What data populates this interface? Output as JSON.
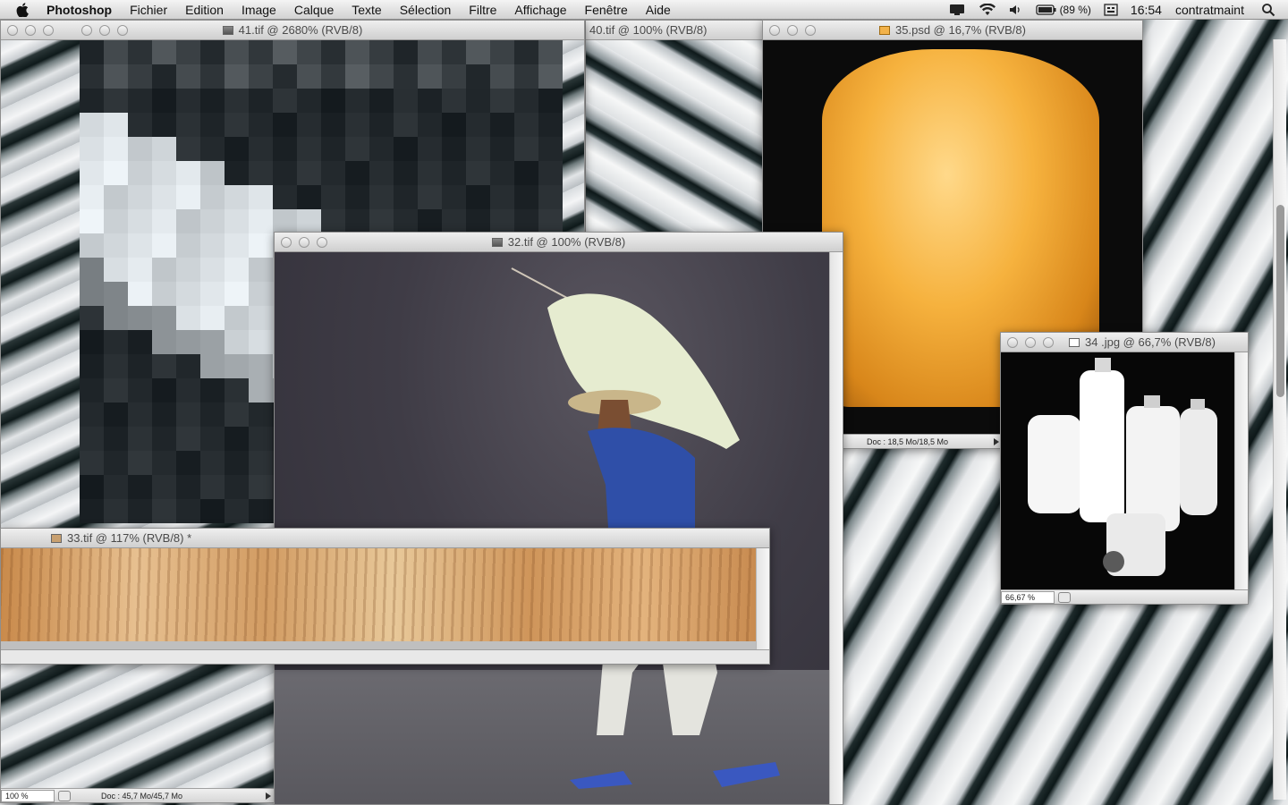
{
  "menubar": {
    "apple_icon": "apple-logo-icon",
    "app_name": "Photoshop",
    "items": [
      "Fichier",
      "Edition",
      "Image",
      "Calque",
      "Texte",
      "Sélection",
      "Filtre",
      "Affichage",
      "Fenêtre",
      "Aide"
    ],
    "battery": "(89 %)",
    "clock": "16:54",
    "user": "contratmaint",
    "status_icons": [
      "display-icon",
      "wifi-icon",
      "volume-icon",
      "battery-icon",
      "keyboard-icon",
      "spotlight-search-icon"
    ]
  },
  "windows": {
    "w41": {
      "title": "41.tif @ 2680% (RVB/8)",
      "zoom": "100 %",
      "doc": "Doc : 45,7 Mo/45,7 Mo"
    },
    "w40": {
      "title": "40.tif @ 100% (RVB/8)"
    },
    "w35": {
      "title": "35.psd @ 16,7% (RVB/8)",
      "doc": "Doc : 18,5 Mo/18,5 Mo"
    },
    "w32": {
      "title": "32.tif @ 100% (RVB/8)"
    },
    "w34": {
      "title": "34 .jpg @ 66,7% (RVB/8)",
      "zoom": "66,67 %"
    },
    "w33": {
      "title": "33.tif @ 117% (RVB/8) *"
    }
  }
}
